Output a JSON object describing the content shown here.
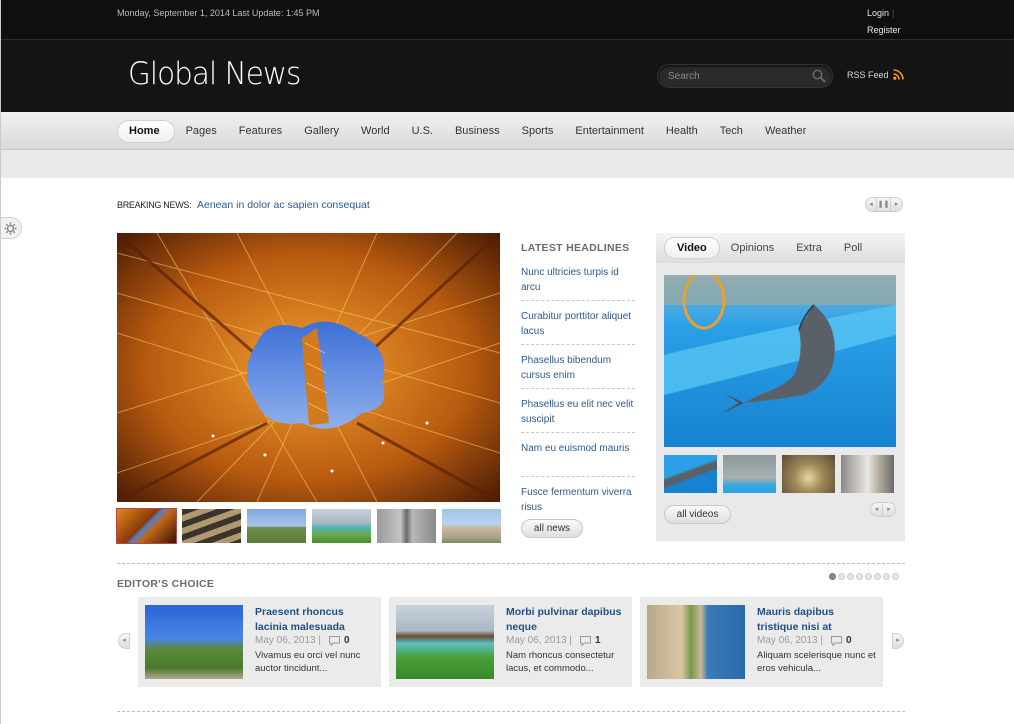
{
  "topbar": {
    "date_text": "Monday, September 1, 2014 Last Update: 1:45 PM",
    "login_label": "Login",
    "login_separator": "|",
    "register_label": "Register"
  },
  "header": {
    "logo_text": "Global News",
    "search_placeholder": "Search",
    "search_value": "",
    "rss_label": "RSS Feed",
    "rss_color": "#f7931e"
  },
  "nav": {
    "items": [
      {
        "label": "Home",
        "active": true
      },
      {
        "label": "Pages"
      },
      {
        "label": "Features"
      },
      {
        "label": "Gallery"
      },
      {
        "label": "World"
      },
      {
        "label": "U.S."
      },
      {
        "label": "Business"
      },
      {
        "label": "Sports"
      },
      {
        "label": "Entertainment"
      },
      {
        "label": "Health"
      },
      {
        "label": "Tech"
      },
      {
        "label": "Weather"
      }
    ]
  },
  "breaking": {
    "label": "BREAKING NEWS:",
    "headline": "Aenean in dolor ac sapien consequat",
    "controls": {
      "prev": "◂",
      "pause": "❚❚",
      "next": "▸"
    }
  },
  "slideshow": {
    "main_image": "eiffel-tower-underside",
    "thumbnails": [
      "eiffel-tower",
      "wine-cellar-barrels",
      "windmills-field",
      "water-bungalows",
      "stone-alley",
      "mosque-domes"
    ]
  },
  "headlines": {
    "title": "LATEST HEADLINES",
    "items": [
      "Nunc ultricies turpis id arcu",
      "Curabitur porttitor aliquet lacus",
      "Phasellus bibendum cursus enim",
      "Phasellus eu elit nec velit suscipit",
      "Nam eu euismod mauris",
      "Fusce fermentum viverra risus"
    ],
    "all_button": "all news"
  },
  "media_box": {
    "tabs": [
      {
        "label": "Video",
        "active": true
      },
      {
        "label": "Opinions"
      },
      {
        "label": "Extra"
      },
      {
        "label": "Poll"
      }
    ],
    "main_video": "dolphin-show",
    "thumbnails": [
      "dolphin-jump",
      "trainer-poolside",
      "golden-altar",
      "city-street"
    ],
    "all_button": "all videos",
    "controls": {
      "prev": "◂",
      "next": "▸"
    }
  },
  "editors_choice": {
    "title": "EDITOR'S CHOICE",
    "page_count": 8,
    "current_page": 1,
    "arrows": {
      "prev": "◂",
      "next": "▸"
    },
    "cards": [
      {
        "title": "Praesent rhoncus lacinia malesuada",
        "date": "May 06, 2013",
        "comments": "0",
        "excerpt": "Vivamus eu orci vel nunc auctor tincidunt...",
        "image": "windmills-bicycles"
      },
      {
        "title": "Morbi pulvinar dapibus neque",
        "date": "May 06, 2013",
        "comments": "1",
        "excerpt": "Nam rhoncus consectetur lacus, et commodo...",
        "image": "tropical-bungalows"
      },
      {
        "title": "Mauris dapibus tristique nisi at",
        "date": "May 06, 2013",
        "comments": "0",
        "excerpt": "Aliquam scelerisque nunc et eros vehicula...",
        "image": "coastal-cliff"
      }
    ]
  },
  "colors": {
    "link": "#2e5a8e",
    "card_title": "#1f4f86",
    "header_bg": "#141414"
  }
}
